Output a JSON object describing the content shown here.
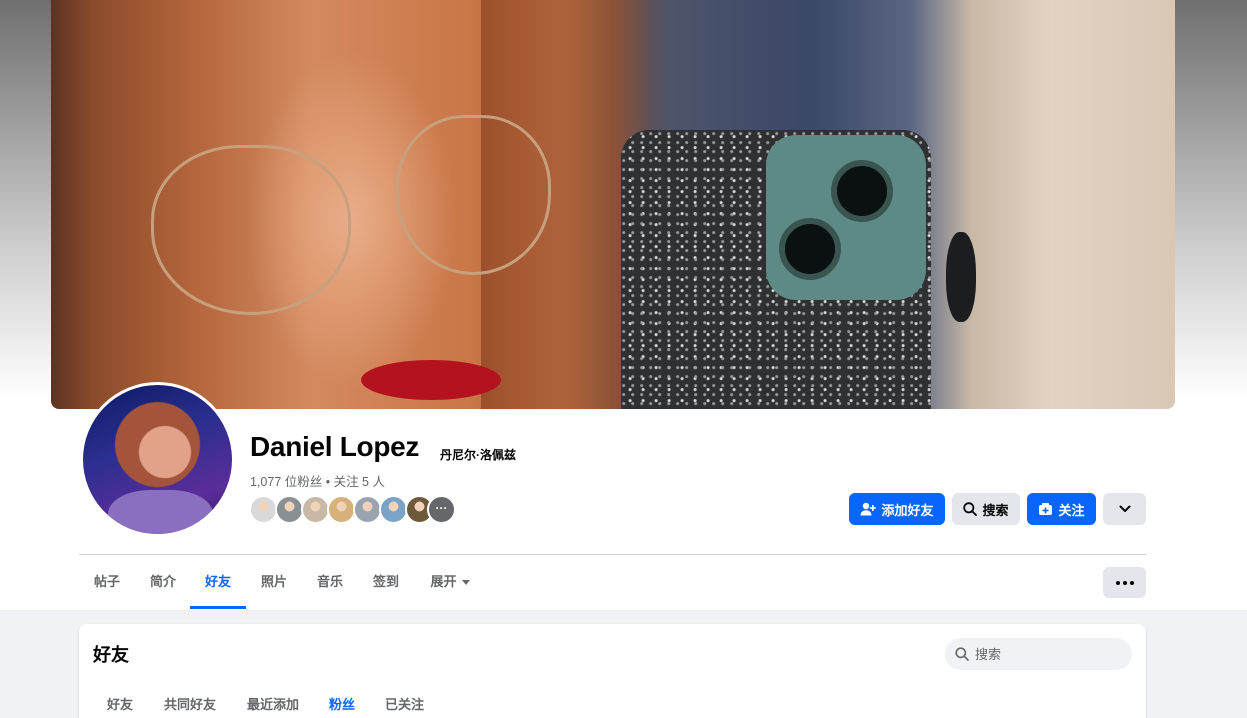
{
  "profile": {
    "name": "Daniel Lopez",
    "alternate_name": "丹尼尔·洛佩兹",
    "stats": "1,077 位粉丝 • 关注 5 人",
    "friend_faces": [
      {
        "color": "#d9d9d9"
      },
      {
        "color": "#8a8f94"
      },
      {
        "color": "#c8b8a6"
      },
      {
        "color": "#d6b27a"
      },
      {
        "color": "#9aa4b0"
      },
      {
        "color": "#7aa3c7"
      },
      {
        "color": "#6e5a3b"
      }
    ],
    "more_faces_label": "···"
  },
  "actions": {
    "add_friend": "添加好友",
    "search": "搜索",
    "follow": "关注"
  },
  "tabs": [
    {
      "label": "帖子"
    },
    {
      "label": "简介"
    },
    {
      "label": "好友"
    },
    {
      "label": "照片"
    },
    {
      "label": "音乐"
    },
    {
      "label": "签到"
    },
    {
      "label": "展开"
    }
  ],
  "active_tab": "好友",
  "friends_section": {
    "title": "好友",
    "search_placeholder": "搜索",
    "subtabs": [
      {
        "label": "好友"
      },
      {
        "label": "共同好友"
      },
      {
        "label": "最近添加"
      },
      {
        "label": "粉丝"
      },
      {
        "label": "已关注"
      }
    ],
    "active_subtab": "粉丝"
  },
  "colors": {
    "accent": "#0866ff",
    "secondary_button": "#e4e6eb",
    "page_background": "#f0f2f5"
  }
}
